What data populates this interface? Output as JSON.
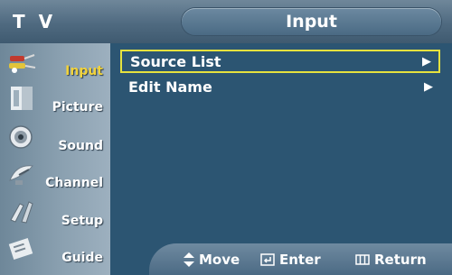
{
  "header": {
    "mode": "T V",
    "title": "Input"
  },
  "sidebar": {
    "items": [
      {
        "label": "Input",
        "icon": "input-plugs-icon",
        "active": true
      },
      {
        "label": "Picture",
        "icon": "picture-icon",
        "active": false
      },
      {
        "label": "Sound",
        "icon": "speaker-icon",
        "active": false
      },
      {
        "label": "Channel",
        "icon": "satellite-dish-icon",
        "active": false
      },
      {
        "label": "Setup",
        "icon": "setup-icon",
        "active": false
      },
      {
        "label": "Guide",
        "icon": "guide-icon",
        "active": false
      }
    ]
  },
  "menu": {
    "items": [
      {
        "label": "Source List",
        "arrow": "▶",
        "selected": true
      },
      {
        "label": "Edit Name",
        "arrow": "▶",
        "selected": false
      }
    ]
  },
  "footer": {
    "move": "Move",
    "enter": "Enter",
    "return": "Return"
  },
  "colors": {
    "background": "#2c5572",
    "selection_border": "#e6e23e",
    "active_label": "#f1d23a"
  }
}
